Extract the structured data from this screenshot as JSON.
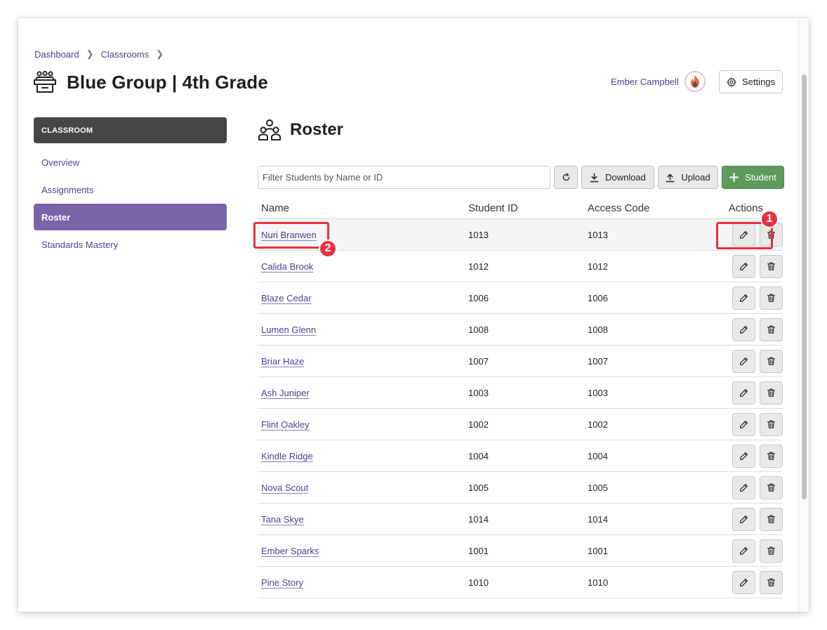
{
  "breadcrumb": {
    "items": [
      "Dashboard",
      "Classrooms"
    ]
  },
  "page": {
    "title": "Blue Group | 4th Grade"
  },
  "header": {
    "user_name": "Ember Campbell",
    "settings_label": "Settings"
  },
  "sidebar": {
    "header": "CLASSROOM",
    "items": [
      {
        "label": "Overview"
      },
      {
        "label": "Assignments"
      },
      {
        "label": "Roster"
      },
      {
        "label": "Standards Mastery"
      }
    ],
    "active": "Roster"
  },
  "roster": {
    "title": "Roster",
    "filter_placeholder": "Filter Students by Name or ID",
    "download_label": "Download",
    "upload_label": "Upload",
    "add_student_label": "Student",
    "columns": [
      "Name",
      "Student ID",
      "Access Code",
      "Actions"
    ],
    "rows": [
      {
        "name": "Nuri Branwen",
        "student_id": "1013",
        "access_code": "1013"
      },
      {
        "name": "Calida Brook",
        "student_id": "1012",
        "access_code": "1012"
      },
      {
        "name": "Blaze Cedar",
        "student_id": "1006",
        "access_code": "1006"
      },
      {
        "name": "Lumen Glenn",
        "student_id": "1008",
        "access_code": "1008"
      },
      {
        "name": "Briar Haze",
        "student_id": "1007",
        "access_code": "1007"
      },
      {
        "name": "Ash Juniper",
        "student_id": "1003",
        "access_code": "1003"
      },
      {
        "name": "Flint Oakley",
        "student_id": "1002",
        "access_code": "1002"
      },
      {
        "name": "Kindle Ridge",
        "student_id": "1004",
        "access_code": "1004"
      },
      {
        "name": "Nova Scout",
        "student_id": "1005",
        "access_code": "1005"
      },
      {
        "name": "Tana Skye",
        "student_id": "1014",
        "access_code": "1014"
      },
      {
        "name": "Ember Sparks",
        "student_id": "1001",
        "access_code": "1001"
      },
      {
        "name": "Pine Story",
        "student_id": "1010",
        "access_code": "1010"
      }
    ]
  },
  "callouts": {
    "first": "1",
    "second": "2"
  },
  "colors": {
    "accent": "#7a64a8",
    "link": "#4b3f8f",
    "add_button": "#5d9a5b",
    "callout": "#e8313f"
  }
}
